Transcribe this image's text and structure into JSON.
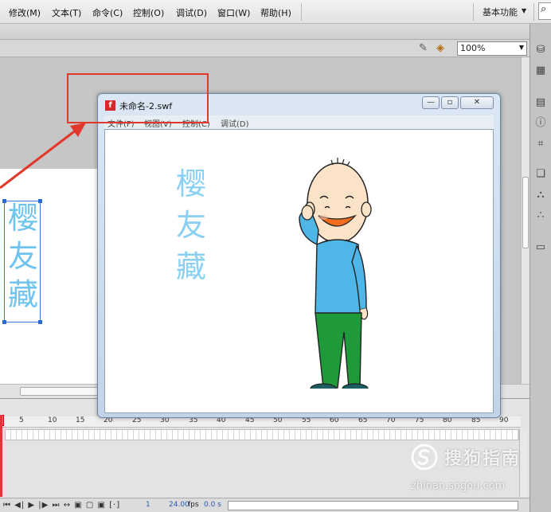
{
  "menubar": {
    "items": [
      "修改(M)",
      "文本(T)",
      "命令(C)",
      "控制(O)",
      "调试(D)",
      "窗口(W)",
      "帮助(H)"
    ],
    "workspace": "基本功能",
    "search_icon": "search-icon"
  },
  "toolbar": {
    "zoom": "100%",
    "icons": [
      "edit-scene-icon",
      "edit-symbol-icon"
    ]
  },
  "stage": {
    "text": "樱友藏"
  },
  "swf_window": {
    "title": "未命名-2.swf",
    "menu": [
      "文件(F)",
      "视图(V)",
      "控制(C)",
      "调试(D)"
    ],
    "min_label": "—",
    "max_label": "▫",
    "close_label": "✕",
    "content_text": "樱友藏"
  },
  "timeline": {
    "ruler": [
      "5",
      "10",
      "15",
      "20",
      "25",
      "30",
      "35",
      "40",
      "45",
      "50",
      "55",
      "60",
      "65",
      "70",
      "75",
      "80",
      "85",
      "90"
    ],
    "controls": "⏮ ◀| ▶ |▶ ⏭  ↔  ▣ ▢ ▣ [·]",
    "current_frame": "1",
    "fps": "24.00",
    "fps_unit": "fps",
    "time": "0.0 s"
  },
  "right_panel": {
    "tools": [
      "paint-bucket-icon",
      "grid-icon",
      "align-icon",
      "info-icon",
      "transform-icon",
      "components-icon",
      "library-icon",
      "motion-presets-icon",
      "panel-toggle-icon"
    ]
  },
  "colors": {
    "highlight": "#e2372b",
    "stage_text": "#6ec4ef"
  },
  "watermark": {
    "brand": "搜狗指南",
    "url": "zhinan.sogou.com"
  }
}
